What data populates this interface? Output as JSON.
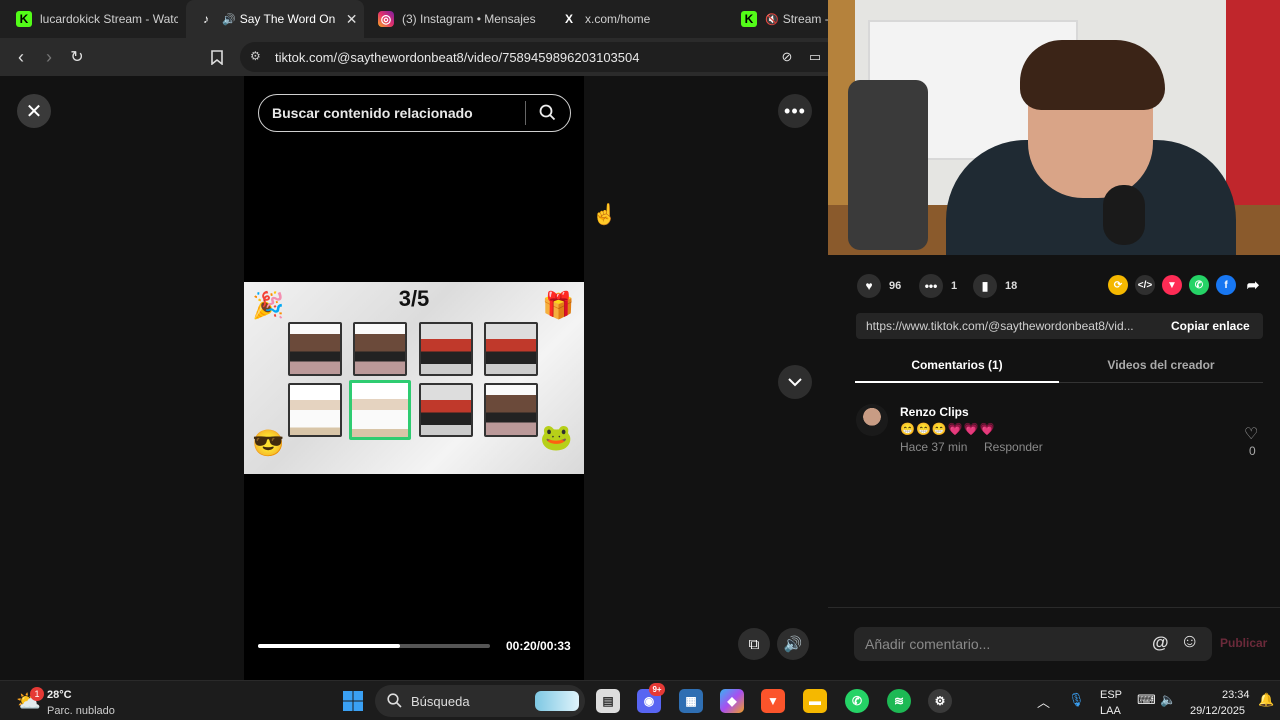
{
  "browser": {
    "tabs": [
      {
        "title": "lucardokick Stream - Watc",
        "favicon": "K",
        "favicon_color": "#53fc18"
      },
      {
        "title": "Say The Word On B",
        "favicon": "♪",
        "favicon_color": "#ffffff",
        "active": true
      },
      {
        "title": "(3) Instagram • Mensajes",
        "favicon": "◎",
        "favicon_color": "#e1306c"
      },
      {
        "title": "x.com/home",
        "favicon": "X",
        "favicon_color": "#ffffff"
      },
      {
        "title": "Stream - I",
        "favicon": "K",
        "favicon_color": "#53fc18"
      }
    ],
    "url": "tiktok.com/@saythewordonbeat8/video/7589459896203103504"
  },
  "video": {
    "search_placeholder": "Buscar contenido relacionado",
    "game_score": "3/5",
    "time": "00:20/00:33",
    "progress": 0.61
  },
  "panel": {
    "likes": "96",
    "comments": "1",
    "saves": "18",
    "link": "https://www.tiktok.com/@saythewordonbeat8/vid...",
    "copy_label": "Copiar enlace",
    "tab_comments": "Comentarios (1)",
    "tab_creator": "Videos del creador",
    "comment": {
      "author": "Renzo Clips",
      "text": "😁😁😁💗💗💗",
      "time": "Hace 37 min",
      "reply": "Responder",
      "likes": "0"
    },
    "input_placeholder": "Añadir comentario...",
    "publish_label": "Publicar"
  },
  "taskbar": {
    "weather_temp": "28°C",
    "weather_desc": "Parc. nublado",
    "weather_badge": "1",
    "search_label": "Búsqueda",
    "lang_top": "ESP",
    "lang_bottom": "LAA",
    "time": "23:34",
    "date": "29/12/2025",
    "discord_badge": "9+"
  },
  "colors": {
    "accent_pink": "#fe2c55",
    "selected_card": "#2ecc71"
  }
}
